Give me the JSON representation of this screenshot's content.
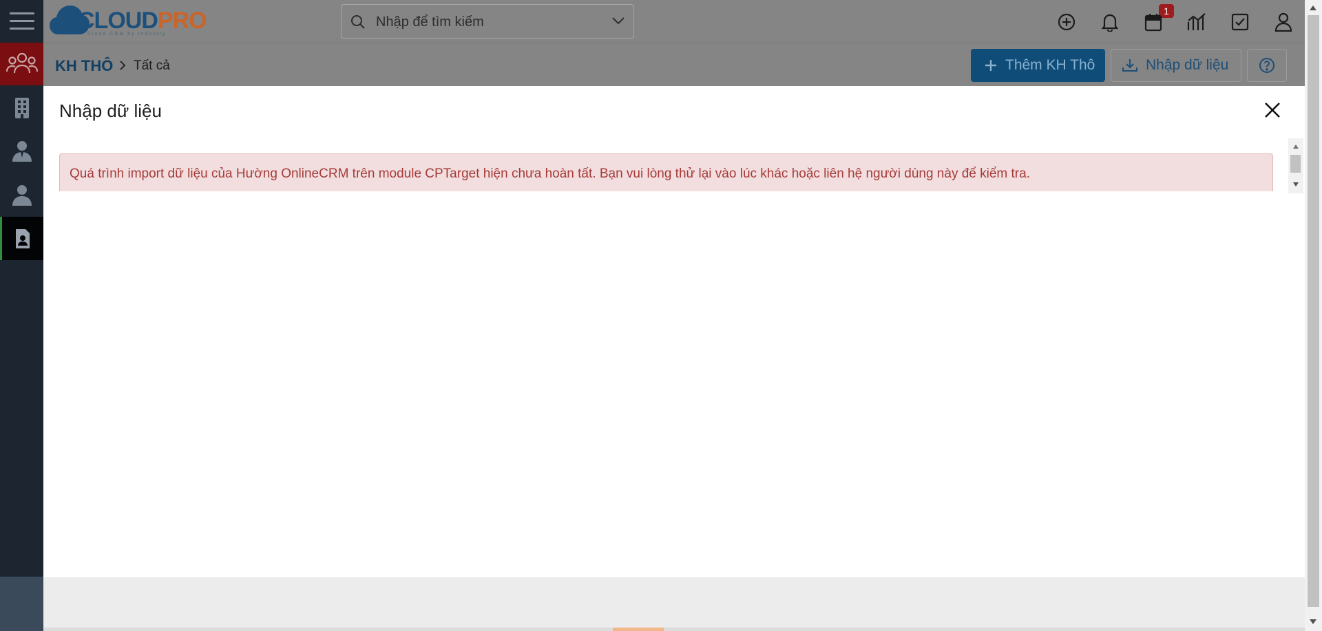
{
  "app": {
    "logo_text_main": "CLOUD",
    "logo_text_accent": "PRO",
    "logo_tagline": "Cloud CRM by Industry"
  },
  "header": {
    "search_placeholder": "Nhập để tìm kiếm",
    "notification_count": "1",
    "icons": [
      "plus-circle-icon",
      "bell-icon",
      "calendar-icon",
      "chart-icon",
      "checkbox-icon",
      "user-icon"
    ]
  },
  "sidebar": {
    "items": [
      "menu-icon",
      "leads-icon",
      "building-icon",
      "contacts-icon",
      "person-icon",
      "document-icon"
    ]
  },
  "breadcrumb": {
    "module": "KH THÔ",
    "current": "Tất cả"
  },
  "toolbar": {
    "add_label": "Thêm KH Thô",
    "import_label": "Nhập dữ liệu"
  },
  "modal": {
    "title": "Nhập dữ liệu",
    "alert_message": "Quá trình import dữ liệu của Hường OnlineCRM trên module CPTarget hiện chưa hoàn tất. Bạn vui lòng thử lại vào lúc khác hoặc liên hệ người dùng này để kiểm tra."
  },
  "colors": {
    "sidebar_bg": "#1c2530",
    "sidebar_active": "#7a0e11",
    "overlay_gray": "#858585",
    "primary_button": "#0f4c78",
    "alert_bg": "#f2dede",
    "alert_text": "#a63a3a",
    "badge": "#9e1b1e"
  }
}
